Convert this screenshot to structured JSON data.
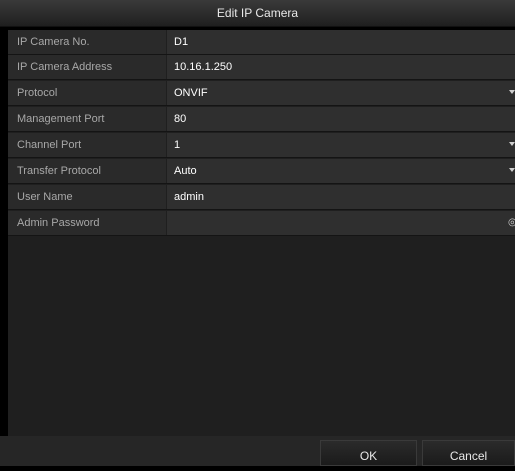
{
  "dialog": {
    "title": "Edit IP Camera",
    "fields": [
      {
        "label": "IP Camera No.",
        "value": "D1",
        "control": "text"
      },
      {
        "label": "IP Camera Address",
        "value": "10.16.1.250",
        "control": "text"
      },
      {
        "label": "Protocol",
        "value": "ONVIF",
        "control": "dropdown"
      },
      {
        "label": "Management Port",
        "value": "80",
        "control": "text"
      },
      {
        "label": "Channel Port",
        "value": "1",
        "control": "dropdown"
      },
      {
        "label": "Transfer Protocol",
        "value": "Auto",
        "control": "dropdown"
      },
      {
        "label": "User Name",
        "value": "admin",
        "control": "text"
      },
      {
        "label": "Admin Password",
        "value": "",
        "control": "password"
      }
    ],
    "buttons": {
      "ok": "OK",
      "cancel": "Cancel"
    }
  }
}
